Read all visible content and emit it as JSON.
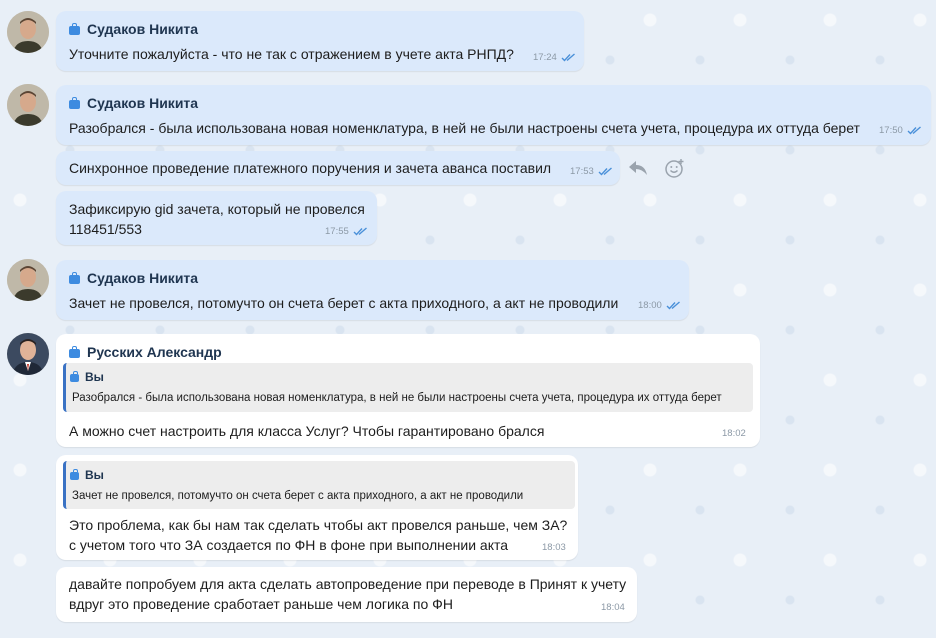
{
  "colors": {
    "accent": "#3d8be0",
    "incoming_bubble": "#dbe9fb",
    "outgoing_bubble": "#ffffff",
    "quote_bar": "#3a72c4"
  },
  "messages": [
    {
      "sender": "Судаков Никита",
      "text": "Уточните пожалуйста - что не так с отражением в учете акта РНПД?",
      "time": "17:24"
    },
    {
      "sender": "Судаков Никита",
      "text": "Разобрался - была использована новая номенклатура, в ней не были настроены счета учета, процедура их оттуда берет",
      "time": "17:50"
    },
    {
      "text": "Синхронное проведение платежного поручения и зачета аванса поставил",
      "time": "17:53"
    },
    {
      "lines": [
        "Зафиксирую gid зачета, который не провелся",
        "118451/553"
      ],
      "time": "17:55"
    },
    {
      "sender": "Судаков Никита",
      "text": "Зачет не провелся, потомучто он счета берет с акта приходного, а акт не проводили",
      "time": "18:00"
    },
    {
      "sender": "Русских Александр",
      "quote_sender": "Вы",
      "quote_text": "Разобрался - была использована новая номенклатура, в ней не были настроены счета учета, процедура их оттуда берет",
      "text": "А можно счет настроить для класса Услуг? Чтобы гарантировано брался",
      "time": "18:02"
    },
    {
      "quote_sender": "Вы",
      "quote_text": "Зачет не провелся, потомучто он счета берет с акта приходного, а акт не проводили",
      "lines": [
        "Это проблема, как бы нам так сделать чтобы акт провелся раньше, чем ЗА?",
        "с учетом того что ЗА создается по ФН в фоне при выполнении акта"
      ],
      "time": "18:03"
    },
    {
      "lines": [
        "давайте попробуем для акта сделать автопроведение при переводе в Принят к учету",
        "вдруг это проведение сработает раньше чем логика по ФН"
      ],
      "time": "18:04"
    }
  ]
}
